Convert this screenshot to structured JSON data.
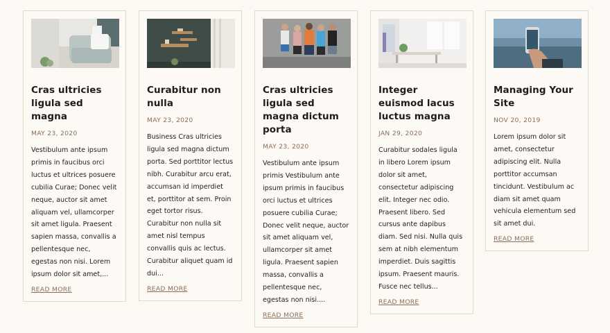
{
  "posts": [
    {
      "image_desc": "living-room-armchair",
      "title": "Cras ultricies ligula sed magna",
      "date": "MAY 23, 2020",
      "excerpt": "Vestibulum ante ipsum primis in faucibus orci luctus et ultrices posuere cubilia Curae; Donec velit neque, auctor sit amet aliquam vel, ullamcorper sit amet ligula. Praesent sapien massa, convallis a pellentesque nec, egestas non nisi. Lorem ipsum dolor sit amet,...",
      "read_more": "READ MORE"
    },
    {
      "image_desc": "wall-shelves",
      "title": "Curabitur non nulla",
      "date": "MAY 23, 2020",
      "excerpt": "Business Cras ultricies ligula sed magna dictum porta. Sed porttitor lectus nibh. Curabitur arcu erat, accumsan id imperdiet et, porttitor at sem. Proin eget tortor risus. Curabitur non nulla sit amet nisl tempus convallis quis ac lectus. Curabitur aliquet quam id dui...",
      "read_more": "READ MORE"
    },
    {
      "image_desc": "group-of-friends",
      "title": "Cras ultricies ligula sed magna dictum porta",
      "date": "MAY 23, 2020",
      "excerpt": "Vestibulum ante ipsum primis Vestibulum ante ipsum primis in faucibus orci luctus et ultrices posuere cubilia Curae; Donec velit neque, auctor sit amet aliquam vel, ullamcorper sit amet ligula. Praesent sapien massa, convallis a pellentesque nec, egestas non nisi....",
      "read_more": "READ MORE"
    },
    {
      "image_desc": "bright-dining-room",
      "title": "Integer euismod lacus luctus magna",
      "date": "JAN 29, 2020",
      "excerpt": "Curabitur sodales ligula in libero Lorem ipsum dolor sit amet, consectetur adipiscing elit. Integer nec odio. Praesent libero. Sed cursus ante dapibus diam. Sed nisi. Nulla quis sem at nibh elementum imperdiet. Duis sagittis ipsum. Praesent mauris. Fusce nec tellus...",
      "read_more": "READ MORE"
    },
    {
      "image_desc": "hand-holding-phone",
      "title": "Managing Your Site",
      "date": "NOV 20, 2019",
      "excerpt": "Lorem ipsum dolor sit amet, consectetur adipiscing elit. Nulla porttitor accumsan tincidunt. Vestibulum ac diam sit amet quam vehicula elementum sed sit amet dui.",
      "read_more": "READ MORE"
    }
  ],
  "colors": {
    "background": "#fcf8f3",
    "card_border": "#e7d8c6",
    "accent": "#8a6d57",
    "text": "#1f1f1f"
  }
}
